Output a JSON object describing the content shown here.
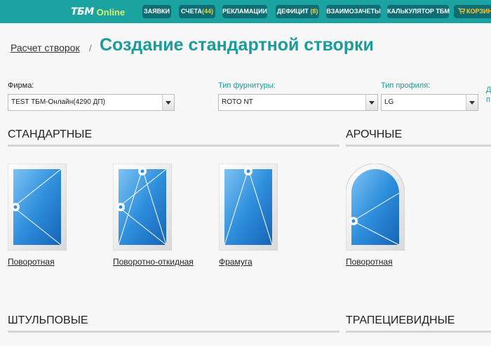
{
  "header": {
    "logo_main": "ТБМ",
    "logo_sub": "Online",
    "nav": [
      {
        "label": "ЗАЯВКИ",
        "count": ""
      },
      {
        "label": "СЧЕТА",
        "count": "(44)"
      },
      {
        "label": "РЕКЛАМАЦИИ",
        "count": ""
      },
      {
        "label": "ДЕФИЦИТ",
        "count": "(8)"
      },
      {
        "label": "ВЗАИМОЗАЧЕТЫ",
        "count": ""
      },
      {
        "label": "КАЛЬКУЛЯТОР ТБМ",
        "count": ""
      },
      {
        "label": "КОРЗИН",
        "count": ""
      }
    ]
  },
  "breadcrumb": {
    "link": "Расчет створок",
    "separator": "/"
  },
  "page_title": "Создание стандартной створки",
  "form": {
    "firm": {
      "label": "Фирма:",
      "value": "TEST ТБМ-Онлайн(4290 ДП)"
    },
    "hardware": {
      "label": "Тип фурнитуры:",
      "value": "ROTO NT"
    },
    "profile": {
      "label": "Тип профиля:",
      "value": "LG"
    },
    "cut_label_top": "Д",
    "cut_label_bottom": "п"
  },
  "sections": {
    "standard": {
      "title": "СТАНДАРТНЫЕ",
      "items": [
        {
          "caption": "Поворотная"
        },
        {
          "caption": "Поворотно-откидная"
        },
        {
          "caption": "Фрамуга"
        }
      ]
    },
    "arched": {
      "title": "АРОЧНЫЕ",
      "items": [
        {
          "caption": "Поворотная"
        }
      ]
    },
    "shtulp": {
      "title": "ШТУЛЬПОВЫЕ"
    },
    "trapezoid": {
      "title": "ТРАПЕЦИЕВИДНЫЕ"
    }
  },
  "colors": {
    "accent": "#1a9d9a",
    "topbar": "#1aa3a0",
    "nav_button": "#0e6e73",
    "glass": "#2f8fdc"
  }
}
